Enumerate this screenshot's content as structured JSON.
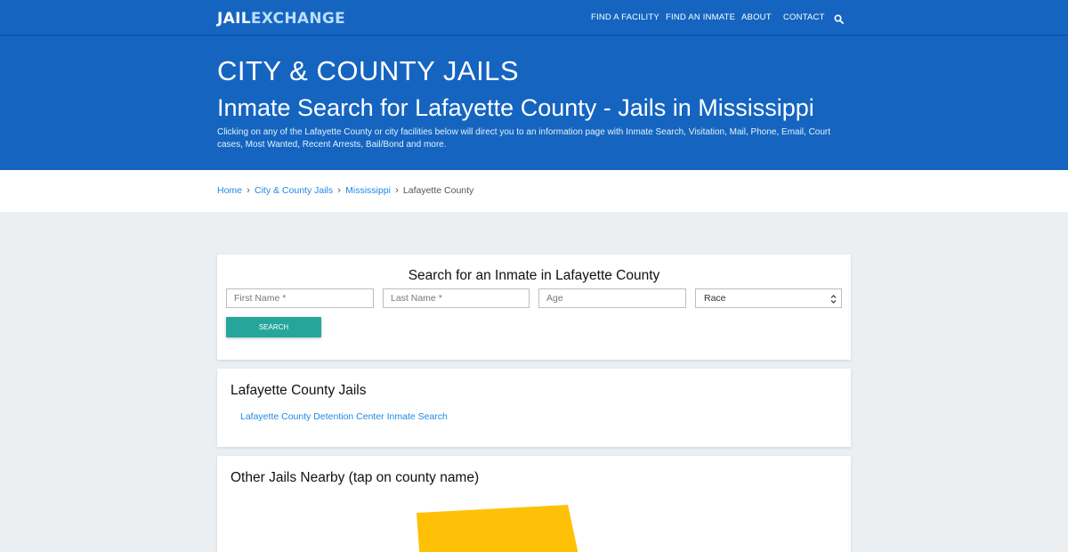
{
  "nav": {
    "logo_part1": "JAIL",
    "logo_part2": "EXCHANGE",
    "links": [
      "FIND A FACILITY",
      "FIND AN INMATE",
      "ABOUT",
      "CONTACT"
    ],
    "search_icon": "search-icon"
  },
  "hero": {
    "kicker": "CITY & COUNTY JAILS",
    "title": "Inmate Search for Lafayette County - Jails in Mississippi",
    "description": "Clicking on any of the Lafayette County or city facilities below will direct you to an information page with Inmate Search, Visitation, Mail, Phone, Email, Court cases, Most Wanted, Recent Arrests, Bail/Bond and more."
  },
  "breadcrumb": {
    "items": [
      "Home",
      "City & County Jails",
      "Mississippi"
    ],
    "current": "Lafayette County",
    "separator_icon": "chevron-right-icon"
  },
  "search_form": {
    "title": "Search for an Inmate in Lafayette County",
    "first_name_placeholder": "First Name *",
    "last_name_placeholder": "Last Name *",
    "age_placeholder": "Age",
    "race_selected": "Race",
    "button_label": "SEARCH"
  },
  "jails_section": {
    "heading": "Lafayette County Jails",
    "links": [
      "Lafayette County Detention Center Inmate Search"
    ]
  },
  "nearby_section": {
    "heading": "Other Jails Nearby (tap on county name)",
    "county_fill_color": "#ffc107"
  },
  "colors": {
    "primary": "#1565c0",
    "link": "#1e88e5",
    "button": "#26a69a",
    "background": "#eceff1"
  }
}
